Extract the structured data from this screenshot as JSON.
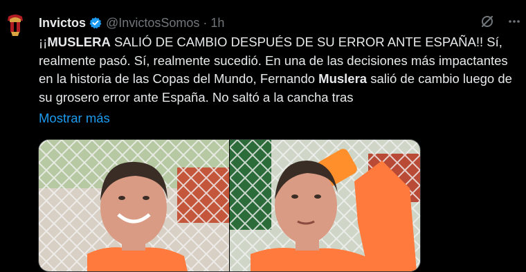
{
  "tweet": {
    "author_name": "Invictos",
    "handle": "@InvictosSomos",
    "separator": "·",
    "time": "1h",
    "text_parts": {
      "p1": "¡¡",
      "p2": "MUSLERA",
      "p3": " SALIÓ DE CAMBIO DESPUÉS DE SU ERROR ANTE ESPAÑA!! Sí, realmente pasó. Sí, realmente sucedió. En una de las decisiones más impactantes en la historia de las Copas del Mundo, Fernando ",
      "p4": "Muslera",
      "p5": " salió de cambio luego de su grosero error ante España. No saltó a la cancha tras"
    },
    "show_more": "Mostrar más"
  },
  "icons": {
    "verified": "verified-badge-icon",
    "grok": "grok-icon",
    "more": "more-options-icon"
  },
  "colors": {
    "background": "#000000",
    "text": "#e7e9ea",
    "muted": "#71767b",
    "link": "#1d9bf0",
    "avatar_red": "#b01e23",
    "avatar_gold": "#d9a441",
    "jersey_orange": "#ff7a3c"
  }
}
